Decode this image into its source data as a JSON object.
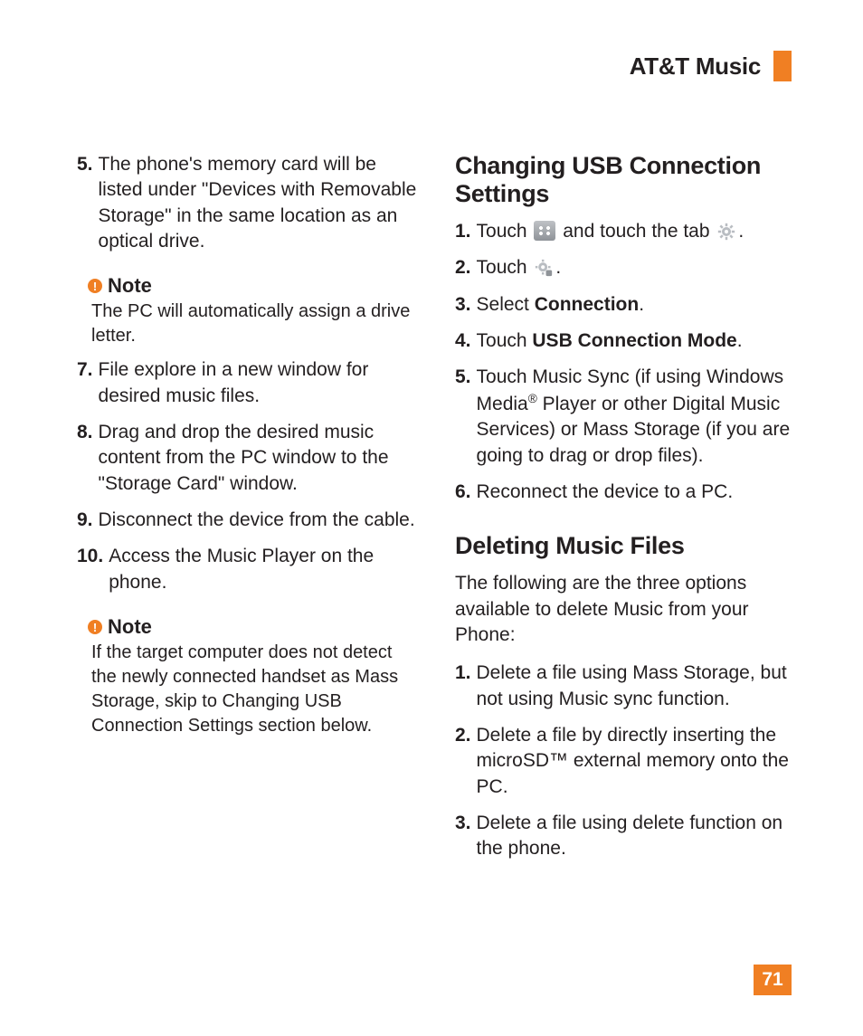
{
  "header": {
    "title": "AT&T Music"
  },
  "page_number": "71",
  "left": {
    "step5": {
      "num": "5.",
      "text": "The phone's memory card will be listed under \"Devices with Removable Storage\" in the same location as an optical drive."
    },
    "note1": {
      "label": "Note",
      "body": "The PC will automatically assign a drive letter."
    },
    "step7": {
      "num": "7.",
      "text": "File explore in a new window for desired music files."
    },
    "step8": {
      "num": "8.",
      "text": "Drag and drop the desired music content from the PC window to the \"Storage Card\" window."
    },
    "step9": {
      "num": "9.",
      "text": "Disconnect the device from the cable."
    },
    "step10": {
      "num": "10.",
      "text": "Access the Music Player on the phone."
    },
    "note2": {
      "label": "Note",
      "body": "If the target computer does not detect the newly connected handset as Mass Storage, skip to Changing USB Connection Settings section below."
    }
  },
  "right": {
    "h2a": "Changing USB Connection Settings",
    "s1": {
      "num": "1.",
      "pre": "Touch ",
      "mid": " and touch the tab ",
      "post": "."
    },
    "s2": {
      "num": "2.",
      "pre": "Touch ",
      "post": "."
    },
    "s3": {
      "num": "3.",
      "pre": "Select ",
      "bold": "Connection",
      "post": "."
    },
    "s4": {
      "num": "4.",
      "pre": "Touch ",
      "bold": "USB Connection Mode",
      "post": "."
    },
    "s5": {
      "num": "5.",
      "pre": "Touch Music Sync (if using Windows Media",
      "sup": "®",
      "post": " Player or other Digital Music Services) or Mass Storage (if you are going to drag or drop files)."
    },
    "s6": {
      "num": "6.",
      "text": "Reconnect the device to a PC."
    },
    "h2b": "Deleting Music Files",
    "intro": "The following are the three options available to delete Music from your Phone:",
    "d1": {
      "num": "1.",
      "text": "Delete a file using Mass Storage, but not using Music sync function."
    },
    "d2": {
      "num": "2.",
      "text": "Delete a file by directly inserting the microSD™ external memory onto the PC."
    },
    "d3": {
      "num": "3.",
      "text": "Delete a file using delete function on the phone."
    }
  },
  "icons": {
    "menu": "menu-icon",
    "gear": "gear-icon",
    "gear_plus": "gear-plus-icon"
  }
}
